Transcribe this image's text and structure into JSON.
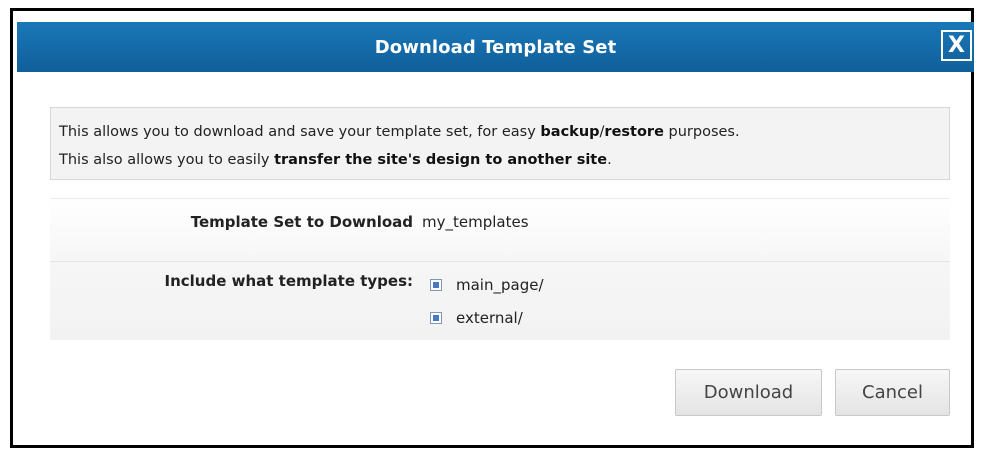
{
  "dialog": {
    "title": "Download Template Set",
    "close_label": "X"
  },
  "info": {
    "line1_pre": "This allows you to download and save your template set, for easy ",
    "line1_bold1": "backup",
    "line1_mid": "/",
    "line1_bold2": "restore",
    "line1_post": " purposes.",
    "line2_pre": "This also allows you to easily ",
    "line2_bold": "transfer the site's design to another site",
    "line2_post": "."
  },
  "fields": {
    "template_set_label": "Template Set to Download",
    "template_set_value": "my_templates",
    "types_label": "Include what template types:",
    "types": [
      {
        "label": "main_page/",
        "checked": true
      },
      {
        "label": "external/",
        "checked": true
      }
    ]
  },
  "buttons": {
    "download": "Download",
    "cancel": "Cancel"
  },
  "colors": {
    "titlebar": "#1166a6",
    "checkbox_fill": "#4a78c6"
  }
}
